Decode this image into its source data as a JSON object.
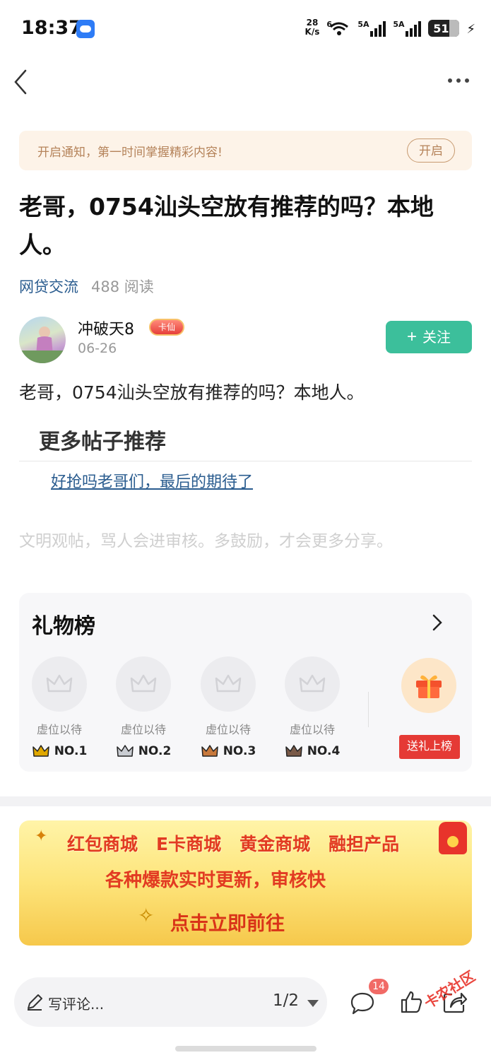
{
  "status_bar": {
    "time": "18:37",
    "net_speed_value": "28",
    "net_speed_unit": "K/s",
    "wifi_label": "6",
    "sim1_label": "5A",
    "sim2_label": "5A",
    "battery": "51"
  },
  "notify_banner": {
    "text": "开启通知，第一时间掌握精彩内容!",
    "button": "开启"
  },
  "post": {
    "title": "老哥，0754汕头空放有推荐的吗？本地人。",
    "category": "网贷交流",
    "reads": "488 阅读",
    "body": "老哥，0754汕头空放有推荐的吗？本地人。"
  },
  "author": {
    "name": "冲破天8",
    "badge": "卡仙",
    "date": "06-26",
    "follow_label": "关注"
  },
  "more_posts": {
    "title": "更多帖子推荐",
    "links": [
      "好抢吗老哥们，最后的期待了"
    ]
  },
  "civility_note": "文明观帖，骂人会进审核。多鼓励，才会更多分享。",
  "gift_board": {
    "title": "礼物榜",
    "slots": [
      {
        "label": "虚位以待",
        "rank": "NO.1",
        "crown_color": "#e0a800"
      },
      {
        "label": "虚位以待",
        "rank": "NO.2",
        "crown_color": "#9aa0a8"
      },
      {
        "label": "虚位以待",
        "rank": "NO.3",
        "crown_color": "#c8793c"
      },
      {
        "label": "虚位以待",
        "rank": "NO.4",
        "crown_color": "#7a5a48"
      }
    ],
    "send_button": "送礼上榜"
  },
  "promo": {
    "row1": [
      "红包商城",
      "E卡商城",
      "黄金商城",
      "融担产品"
    ],
    "row2": "各种爆款实时更新，审核快",
    "row3": "点击立即前往"
  },
  "bottom_bar": {
    "comment_placeholder": "写评论...",
    "page_indicator": "1/2",
    "comment_count": "14"
  },
  "watermark": "卡农社区",
  "colors": {
    "accent_green": "#3cbf9b",
    "link_blue": "#2a5c8f",
    "badge_red": "#e53a35"
  }
}
